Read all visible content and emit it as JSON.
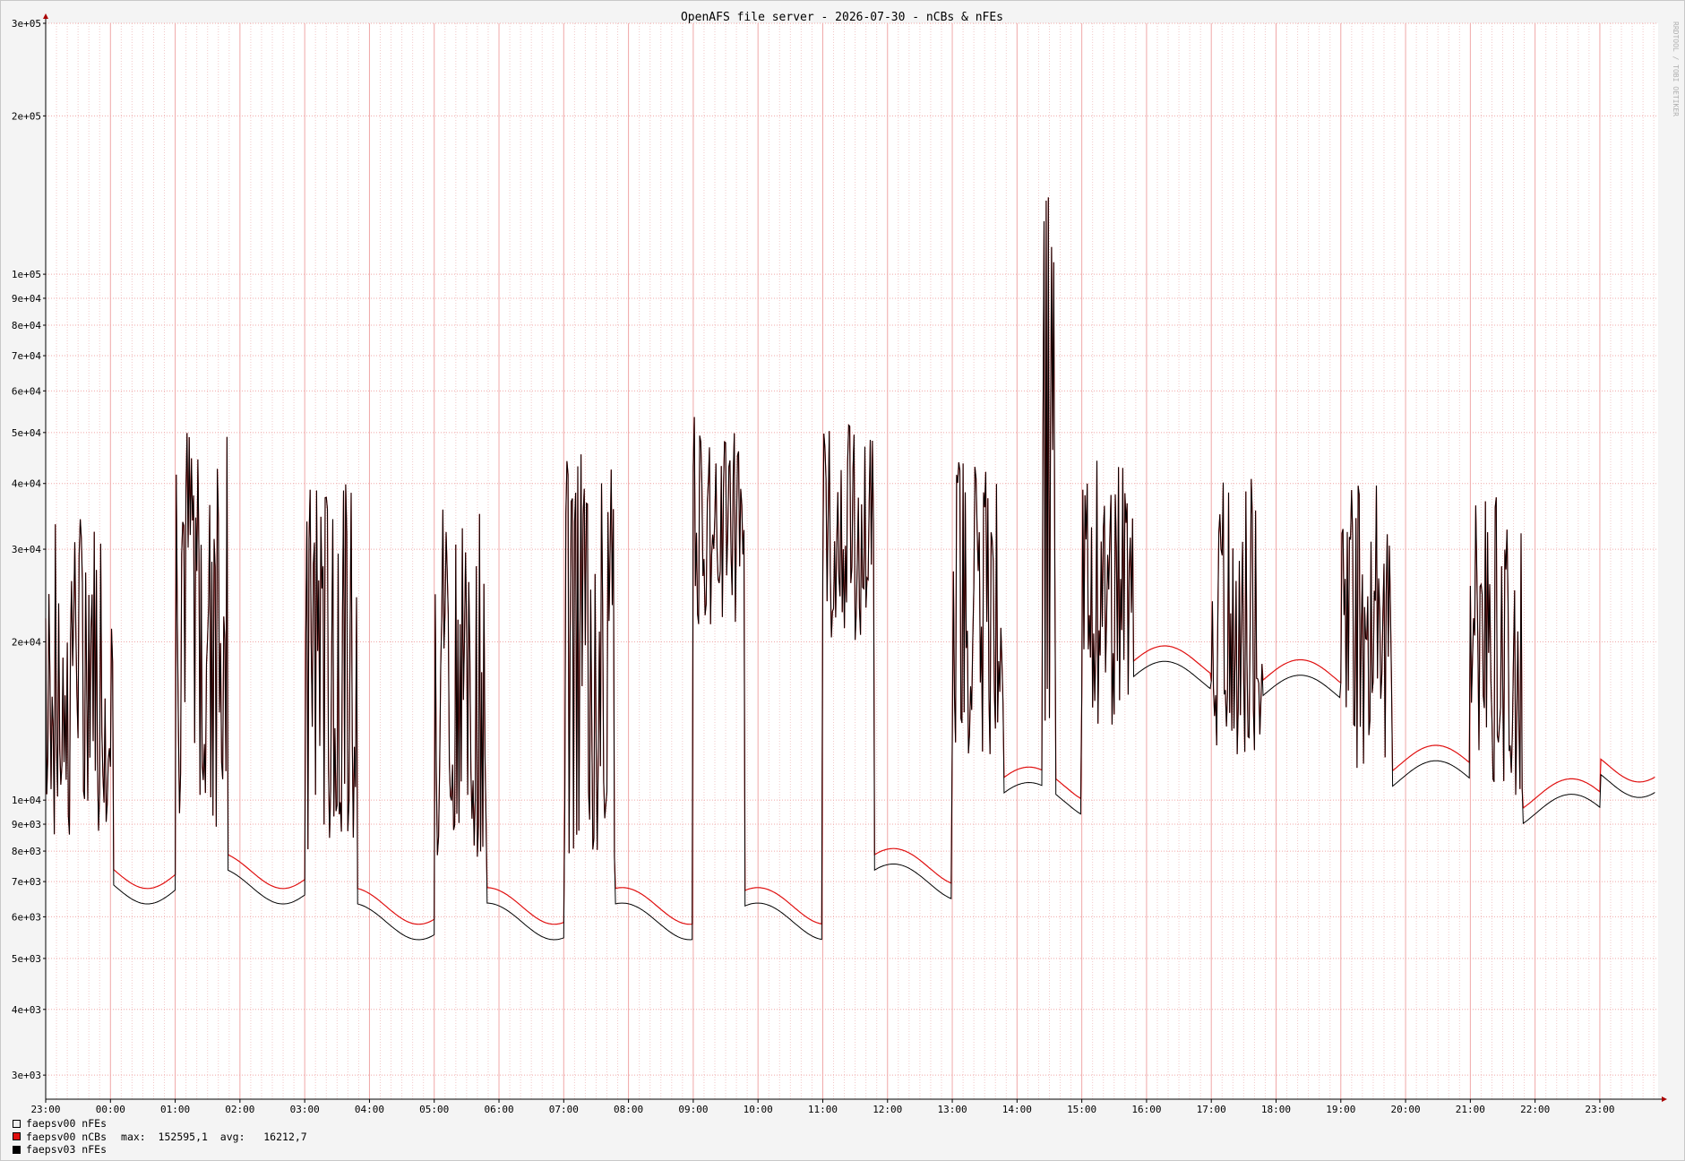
{
  "chart_data": {
    "type": "line",
    "title": "OpenAFS file server - 2026-07-30 - nCBs & nFEs",
    "watermark": "RRDTOOL / TOBI OETIKER",
    "yscale": "log",
    "ylim": [
      2700,
      300000
    ],
    "y_ticks": [
      {
        "v": 300000,
        "label": "3e+05"
      },
      {
        "v": 200000,
        "label": "2e+05"
      },
      {
        "v": 100000,
        "label": "1e+05"
      },
      {
        "v": 90000,
        "label": "9e+04"
      },
      {
        "v": 80000,
        "label": "8e+04"
      },
      {
        "v": 70000,
        "label": "7e+04"
      },
      {
        "v": 60000,
        "label": "6e+04"
      },
      {
        "v": 50000,
        "label": "5e+04"
      },
      {
        "v": 40000,
        "label": "4e+04"
      },
      {
        "v": 30000,
        "label": "3e+04"
      },
      {
        "v": 20000,
        "label": "2e+04"
      },
      {
        "v": 10000,
        "label": "1e+04"
      },
      {
        "v": 9000,
        "label": "9e+03"
      },
      {
        "v": 8000,
        "label": "8e+03"
      },
      {
        "v": 7000,
        "label": "7e+03"
      },
      {
        "v": 6000,
        "label": "6e+03"
      },
      {
        "v": 5000,
        "label": "5e+03"
      },
      {
        "v": 4000,
        "label": "4e+03"
      },
      {
        "v": 3000,
        "label": "3e+03"
      }
    ],
    "x_ticks": [
      "23:00",
      "00:00",
      "01:00",
      "02:00",
      "03:00",
      "04:00",
      "05:00",
      "06:00",
      "07:00",
      "08:00",
      "09:00",
      "10:00",
      "11:00",
      "12:00",
      "13:00",
      "14:00",
      "15:00",
      "16:00",
      "17:00",
      "18:00",
      "19:00",
      "20:00",
      "21:00",
      "22:00",
      "23:00"
    ],
    "x_range_hours": [
      0,
      24.9
    ],
    "grid": true,
    "colors": {
      "background": "#f4f4f4",
      "canvas": "#ffffff",
      "grid": "#f2c8c8",
      "grid_major": "#f0a8a8",
      "ncbs": "#e01010",
      "nfes03": "#000000",
      "nfes00": "#f0f0f0",
      "axis": "#000000"
    },
    "series": [
      {
        "name": "faepsv00 nCBs",
        "color": "#e01010",
        "id": "ncbs"
      },
      {
        "name": "faepsv03 nFEs",
        "color": "#000000",
        "id": "nfes"
      }
    ],
    "segments": [
      {
        "t": [
          0.0,
          1.05
        ],
        "base": 7000,
        "peak": 35000
      },
      {
        "t": [
          2.0,
          2.8
        ],
        "base": 7200,
        "peak": 54000
      },
      {
        "t": [
          4.0,
          4.8
        ],
        "base": 6300,
        "peak": 40000
      },
      {
        "t": [
          6.0,
          6.8
        ],
        "base": 6100,
        "peak": 39000
      },
      {
        "t": [
          8.0,
          8.8
        ],
        "base": 6200,
        "peak": 46000
      },
      {
        "t": [
          10.0,
          10.8
        ],
        "base": 17000,
        "peak": 54000
      },
      {
        "t": [
          12.0,
          12.8
        ],
        "base": 16000,
        "peak": 52000
      },
      {
        "t": [
          14.0,
          14.8
        ],
        "base": 9500,
        "peak": 46000
      },
      {
        "t": [
          15.4,
          15.6
        ],
        "base": 9500,
        "peak": 152595
      },
      {
        "t": [
          16.0,
          16.8
        ],
        "base": 11000,
        "peak": 45000
      },
      {
        "t": [
          18.0,
          18.8
        ],
        "base": 10000,
        "peak": 42000
      },
      {
        "t": [
          20.0,
          20.8
        ],
        "base": 9500,
        "peak": 40000
      },
      {
        "t": [
          22.0,
          22.8
        ],
        "base": 8500,
        "peak": 38000
      }
    ],
    "legend": [
      {
        "label": "faepsv00 nFEs",
        "color": "#f0f0f0"
      },
      {
        "label": "faepsv00 nCBs",
        "color": "#e01010",
        "stats": "max:  152595,1  avg:   16212,7"
      },
      {
        "label": "faepsv03 nFEs",
        "color": "#000000"
      }
    ]
  }
}
